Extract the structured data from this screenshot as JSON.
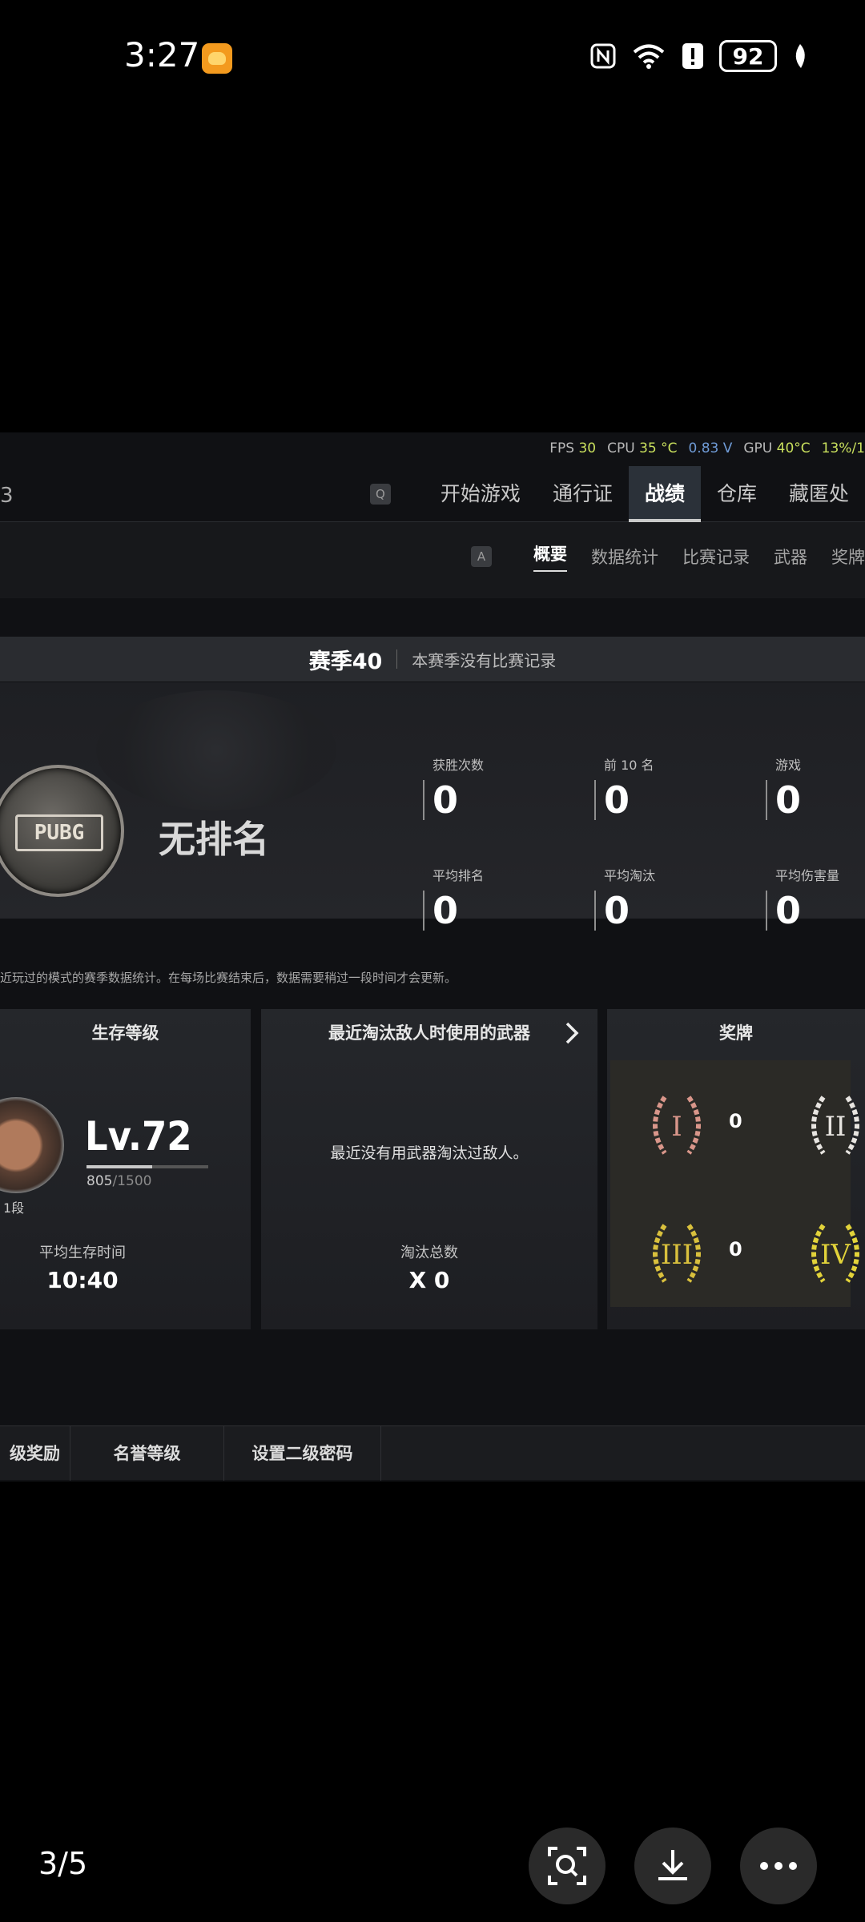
{
  "status_bar": {
    "time": "3:27",
    "battery": "92"
  },
  "game": {
    "hud": [
      {
        "k": "FPS",
        "v": "30"
      },
      {
        "k": "CPU",
        "v": "35 °C"
      },
      {
        "k": "",
        "v": "0.83 V"
      },
      {
        "k": "GPU",
        "v": "40°C"
      },
      {
        "k": "",
        "v": "13%/1"
      }
    ],
    "top_nav": {
      "key_hint": "Q",
      "tabs": [
        "开始游戏",
        "通行证",
        "战绩",
        "仓库",
        "藏匿处"
      ],
      "active_tab": "战绩"
    },
    "sub_nav": {
      "key_hint": "A",
      "tabs": [
        "概要",
        "数据统计",
        "比赛记录",
        "武器",
        "奖牌"
      ],
      "active_tab": "概要"
    },
    "season": {
      "title": "赛季40",
      "note": "本赛季没有比赛记录"
    },
    "rank": {
      "emblem_text": "PUBG",
      "label": "无排名"
    },
    "stats": [
      {
        "label": "获胜次数",
        "value": "0"
      },
      {
        "label": "前 10 名",
        "value": "0"
      },
      {
        "label": "游戏",
        "value": "0"
      },
      {
        "label": "平均排名",
        "value": "0"
      },
      {
        "label": "平均淘汰",
        "value": "0"
      },
      {
        "label": "平均伤害量",
        "value": "0"
      }
    ],
    "footnote": "近玩过的模式的赛季数据统计。在每场比赛结束后，数据需要稍过一段时间才会更新。",
    "survival": {
      "title": "生存等级",
      "level": "Lv.72",
      "xp_current": "805",
      "xp_total": "/1500",
      "xp_fraction": 0.537,
      "tier": "1段",
      "avg_time_label": "平均生存时间",
      "avg_time_value": "10:40"
    },
    "weapon": {
      "title": "最近淘汰敌人时使用的武器",
      "empty_text": "最近没有用武器淘汰过敌人。",
      "kills_label": "淘汰总数",
      "kills_value": "X 0"
    },
    "medals": {
      "title": "奖牌",
      "items": [
        {
          "roman": "I",
          "count": "0",
          "color": "#d9968a"
        },
        {
          "roman": "II",
          "count": "",
          "color": "#e7e4e0"
        },
        {
          "roman": "III",
          "count": "0",
          "color": "#d9c03d"
        },
        {
          "roman": "IV",
          "count": "",
          "color": "#e2d33a"
        }
      ]
    },
    "bottom_tabs": [
      "级奖励",
      "名誉等级",
      "设置二级密码"
    ]
  },
  "viewer": {
    "counter": "3/5",
    "icons": [
      "lens-search-icon",
      "download-icon",
      "more-icon"
    ]
  }
}
